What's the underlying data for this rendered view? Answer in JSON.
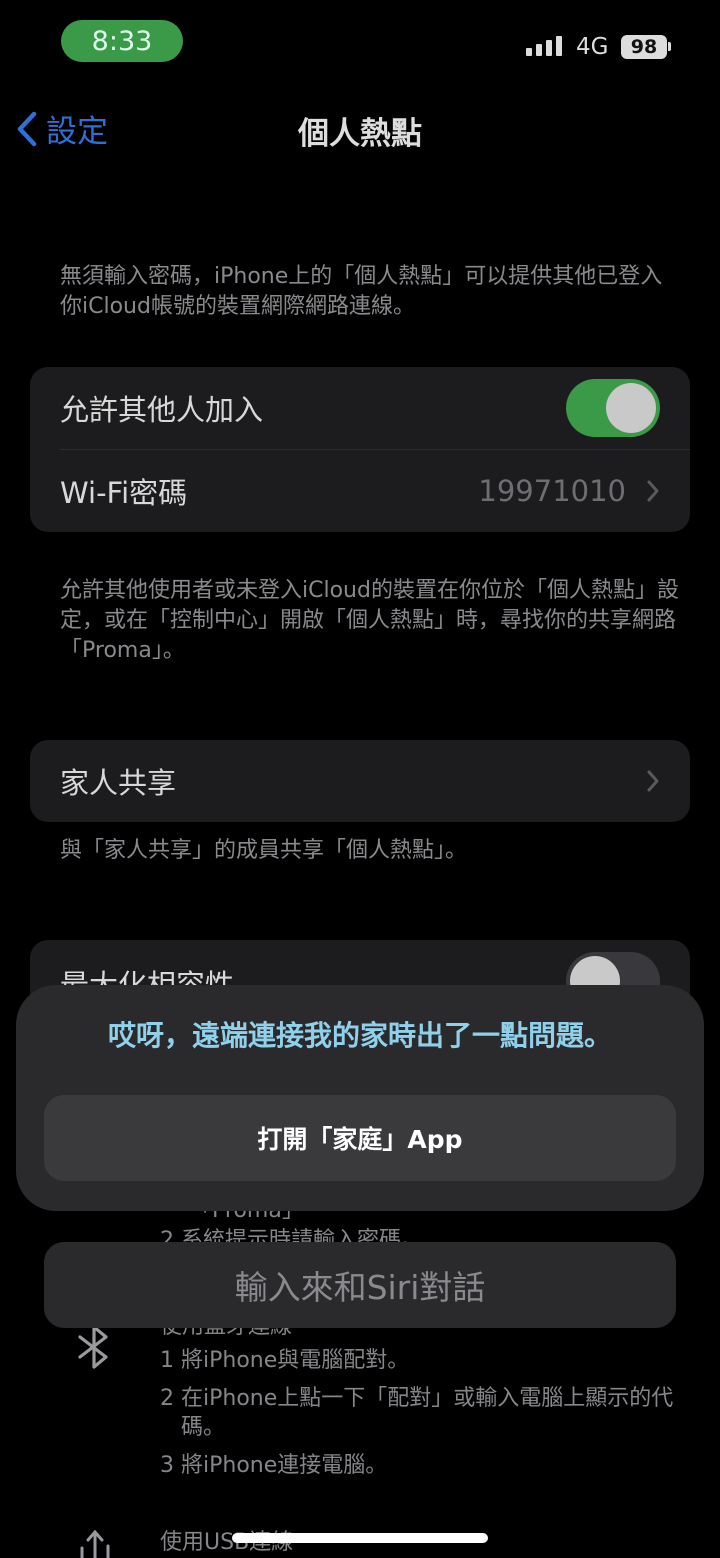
{
  "status_bar": {
    "time": "8:33",
    "network": "4G",
    "battery": "98"
  },
  "nav": {
    "back_label": "設定",
    "title": "個人熱點"
  },
  "hotspot_description": "無須輸入密碼，iPhone上的「個人熱點」可以提供其他已登入你iCloud帳號的裝置網際網路連線。",
  "settings": {
    "allow_others_label": "允許其他人加入",
    "allow_others_on": true,
    "wifi_password_label": "Wi-Fi密碼",
    "wifi_password_value": "19971010"
  },
  "allow_description": "允許其他使用者或未登入iCloud的裝置在你位於「個人熱點」設定，或在「控制中心」開啟「個人熱點」時，尋找你的共享網路「Proma」。",
  "family": {
    "label": "家人共享",
    "description": "與「家人共享」的成員共享「個人熱點」。"
  },
  "compat": {
    "label_partial": "最大化相容性",
    "on": false
  },
  "obscured_text": {
    "proma": "「Proma」",
    "step2_partial": "2 系統提示時請輸入密碼。"
  },
  "bluetooth": {
    "heading": "使用藍牙連線",
    "steps": [
      "1 將iPhone與電腦配對。",
      "2 在iPhone上點一下「配對」或輸入電腦上顯示的代碼。",
      "3 將iPhone連接電腦。"
    ]
  },
  "usb": {
    "heading": "使用USB連線"
  },
  "siri": {
    "error_message": "哎呀，遠端連接我的家時出了一點問題。",
    "open_home_button": "打開「家庭」App",
    "input_placeholder": "輸入來和Siri對話"
  },
  "colors": {
    "accent": "#2f6fd6",
    "toggle_on": "#3a9a48",
    "siri_text": "#8fd0ea"
  }
}
